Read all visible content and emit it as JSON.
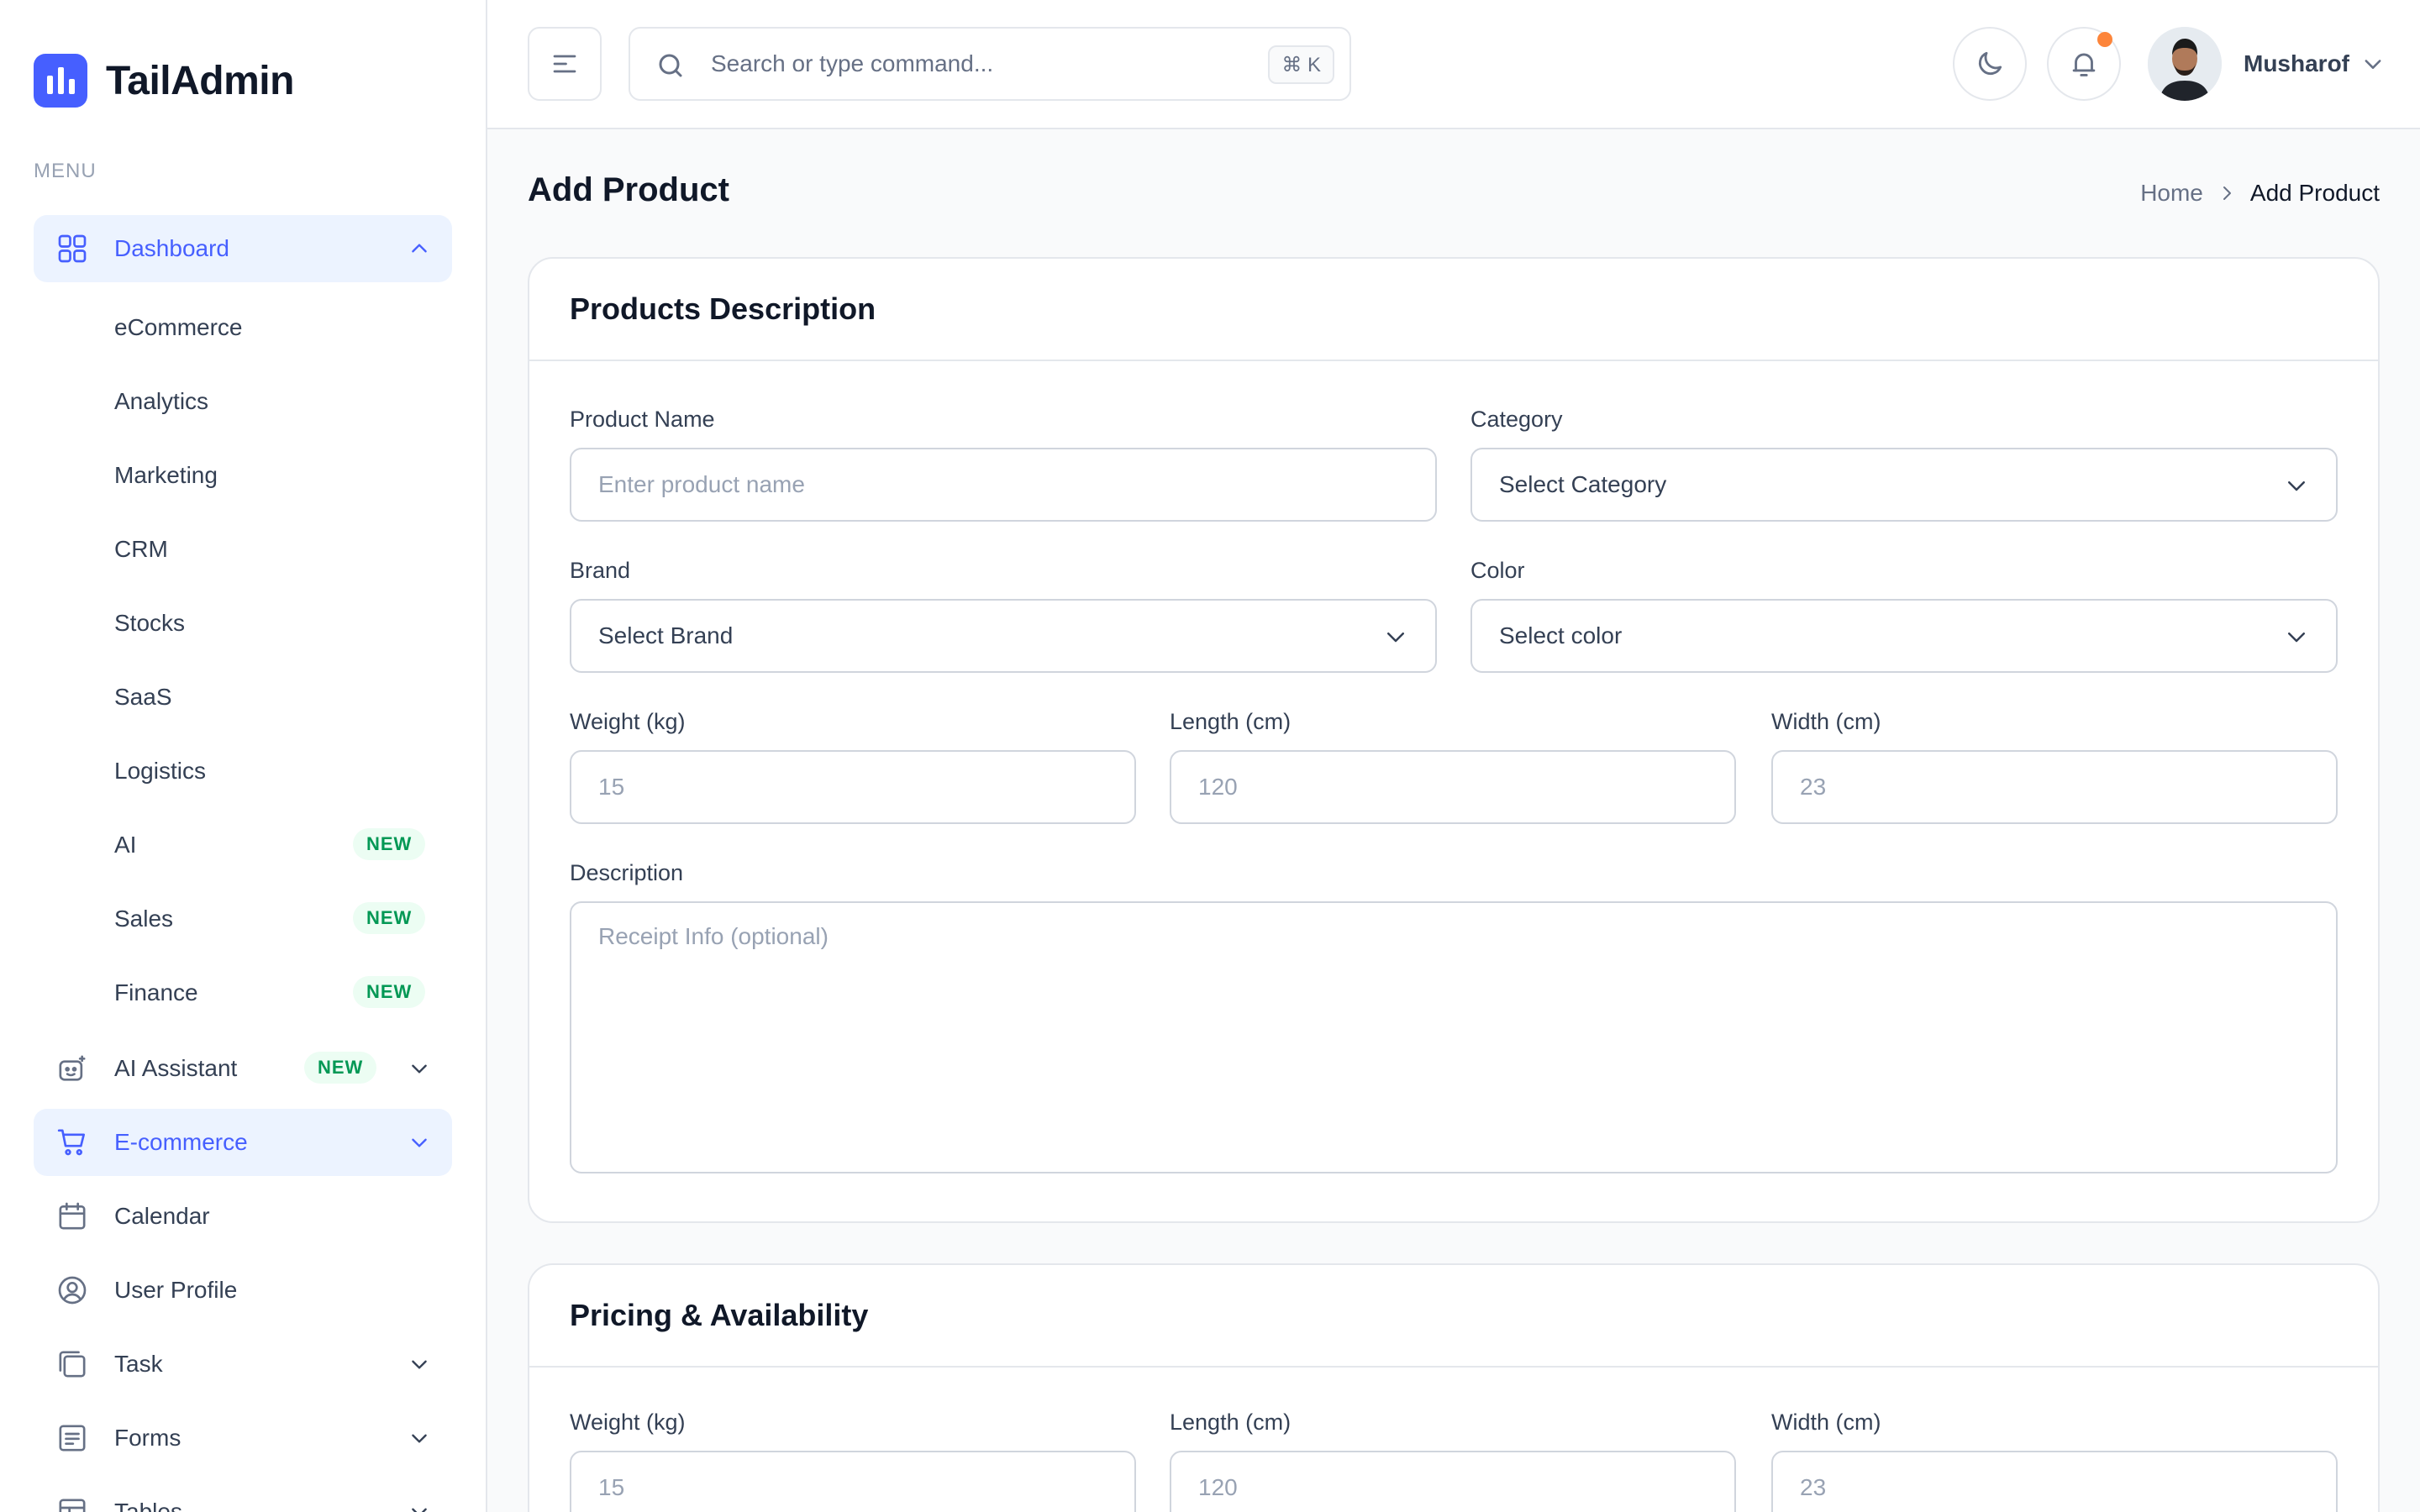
{
  "brand": {
    "name": "TailAdmin"
  },
  "sidebar": {
    "menu_label": "MENU",
    "dashboard": {
      "label": "Dashboard",
      "children": [
        {
          "label": "eCommerce"
        },
        {
          "label": "Analytics"
        },
        {
          "label": "Marketing"
        },
        {
          "label": "CRM"
        },
        {
          "label": "Stocks"
        },
        {
          "label": "SaaS"
        },
        {
          "label": "Logistics"
        },
        {
          "label": "AI",
          "badge": "NEW"
        },
        {
          "label": "Sales",
          "badge": "NEW"
        },
        {
          "label": "Finance",
          "badge": "NEW"
        }
      ]
    },
    "items": [
      {
        "label": "AI Assistant",
        "badge": "NEW",
        "icon": "robot-icon"
      },
      {
        "label": "E-commerce",
        "icon": "cart-icon"
      },
      {
        "label": "Calendar",
        "icon": "calendar-icon"
      },
      {
        "label": "User Profile",
        "icon": "user-circle-icon"
      },
      {
        "label": "Task",
        "icon": "task-icon"
      },
      {
        "label": "Forms",
        "icon": "forms-icon"
      },
      {
        "label": "Tables",
        "icon": "table-icon"
      }
    ]
  },
  "header": {
    "search_placeholder": "Search or type command...",
    "search_shortcut": "⌘ K",
    "user_name": "Musharof"
  },
  "page": {
    "title": "Add Product",
    "breadcrumb": {
      "home": "Home",
      "current": "Add Product"
    }
  },
  "product_description": {
    "title": "Products Description",
    "product_name": {
      "label": "Product Name",
      "placeholder": "Enter product name"
    },
    "category": {
      "label": "Category",
      "value": "Select Category"
    },
    "brand": {
      "label": "Brand",
      "value": "Select Brand"
    },
    "color": {
      "label": "Color",
      "value": "Select color"
    },
    "weight": {
      "label": "Weight (kg)",
      "placeholder": "15"
    },
    "length": {
      "label": "Length (cm)",
      "placeholder": "120"
    },
    "width": {
      "label": "Width (cm)",
      "placeholder": "23"
    },
    "description": {
      "label": "Description",
      "placeholder": "Receipt Info (optional)"
    }
  },
  "pricing": {
    "title": "Pricing & Availability",
    "weight": {
      "label": "Weight (kg)",
      "placeholder": "15"
    },
    "length": {
      "label": "Length (cm)",
      "placeholder": "120"
    },
    "width": {
      "label": "Width (cm)",
      "placeholder": "23"
    }
  },
  "colors": {
    "accent": "#465fff",
    "active_bg": "#ecf3ff",
    "badge_text": "#039855",
    "badge_bg": "#ecfdf3",
    "notification": "#fd853a"
  }
}
